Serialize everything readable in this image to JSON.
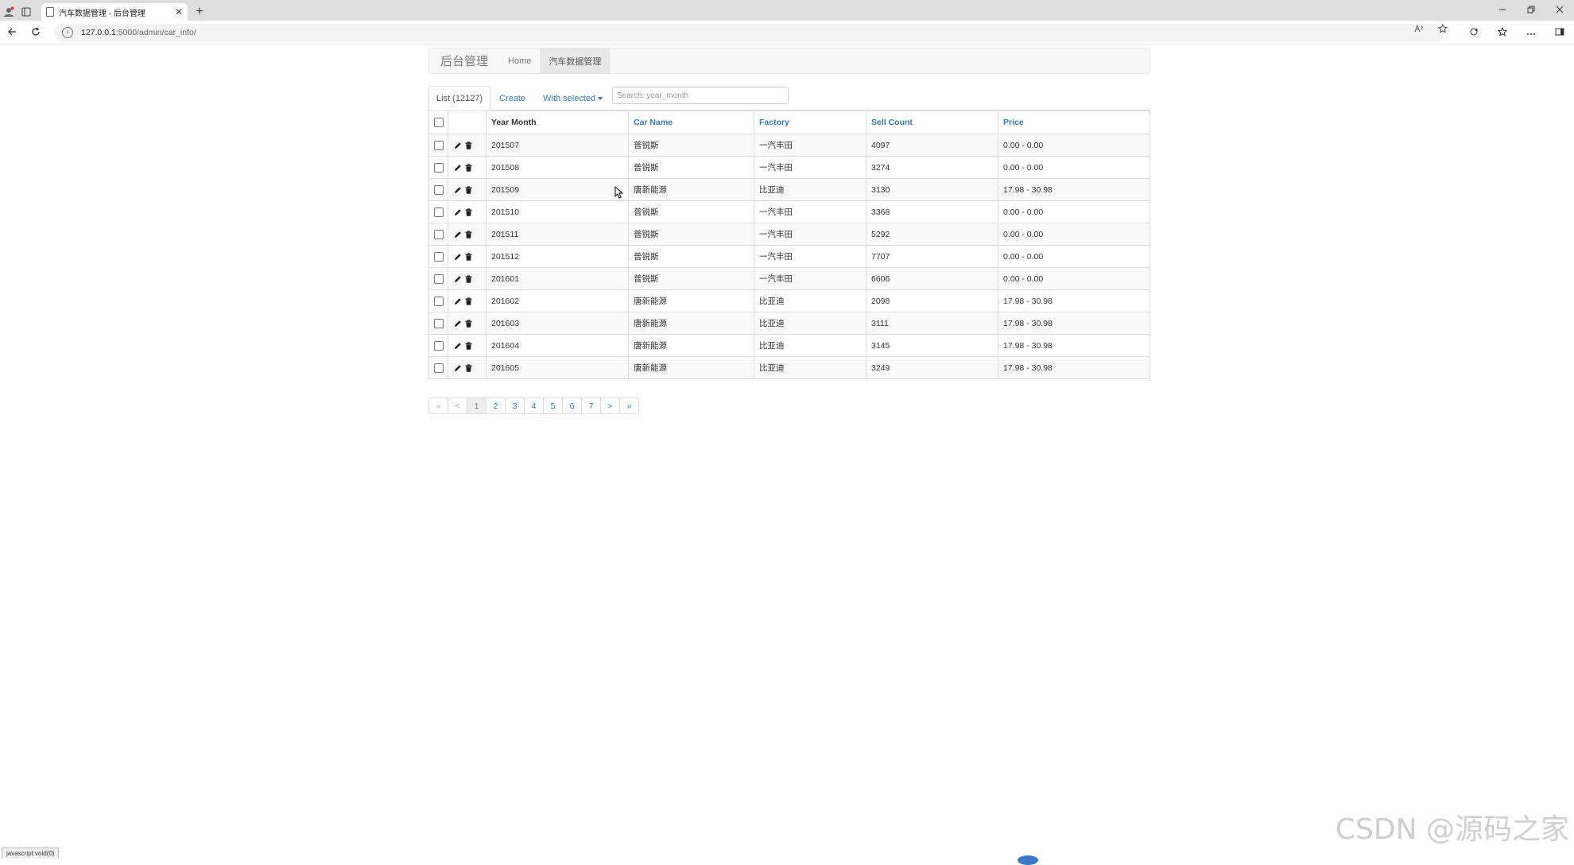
{
  "browser": {
    "tab_title": "汽车数据管理 - 后台管理",
    "tab_close": "✕",
    "new_tab": "+",
    "url_host": "127.0.0.1",
    "url_path": ":5000/admin/car_info/",
    "status_text": "javascript:void(0)"
  },
  "navbar": {
    "brand": "后台管理",
    "links": [
      {
        "label": "Home"
      },
      {
        "label": "汽车数据管理"
      }
    ]
  },
  "toolbar": {
    "list_label": "List (12127)",
    "create_label": "Create",
    "with_selected_label": "With selected"
  },
  "search": {
    "placeholder": "Search: year_month"
  },
  "table": {
    "columns": [
      "Year Month",
      "Car Name",
      "Factory",
      "Sell Count",
      "Price"
    ],
    "rows": [
      {
        "year_month": "201507",
        "car_name": "普锐斯",
        "factory": "一汽丰田",
        "sell_count": "4097",
        "price": "0.00 - 0.00"
      },
      {
        "year_month": "201508",
        "car_name": "普锐斯",
        "factory": "一汽丰田",
        "sell_count": "3274",
        "price": "0.00 - 0.00"
      },
      {
        "year_month": "201509",
        "car_name": "唐新能源",
        "factory": "比亚迪",
        "sell_count": "3130",
        "price": "17.98 - 30.98"
      },
      {
        "year_month": "201510",
        "car_name": "普锐斯",
        "factory": "一汽丰田",
        "sell_count": "3368",
        "price": "0.00 - 0.00"
      },
      {
        "year_month": "201511",
        "car_name": "普锐斯",
        "factory": "一汽丰田",
        "sell_count": "5292",
        "price": "0.00 - 0.00"
      },
      {
        "year_month": "201512",
        "car_name": "普锐斯",
        "factory": "一汽丰田",
        "sell_count": "7707",
        "price": "0.00 - 0.00"
      },
      {
        "year_month": "201601",
        "car_name": "普锐斯",
        "factory": "一汽丰田",
        "sell_count": "6606",
        "price": "0.00 - 0.00"
      },
      {
        "year_month": "201602",
        "car_name": "唐新能源",
        "factory": "比亚迪",
        "sell_count": "2098",
        "price": "17.98 - 30.98"
      },
      {
        "year_month": "201603",
        "car_name": "唐新能源",
        "factory": "比亚迪",
        "sell_count": "3111",
        "price": "17.98 - 30.98"
      },
      {
        "year_month": "201604",
        "car_name": "唐新能源",
        "factory": "比亚迪",
        "sell_count": "3145",
        "price": "17.98 - 30.98"
      },
      {
        "year_month": "201605",
        "car_name": "唐新能源",
        "factory": "比亚迪",
        "sell_count": "3249",
        "price": "17.98 - 30.98"
      }
    ]
  },
  "pagination": {
    "first": "«",
    "prev": "<",
    "pages": [
      "1",
      "2",
      "3",
      "4",
      "5",
      "6",
      "7"
    ],
    "next": ">",
    "last": "»"
  },
  "watermark": "CSDN @源码之家",
  "colors": {
    "link": "#337ab7",
    "navbar_bg": "#f8f8f8",
    "stripe": "#f9f9f9"
  }
}
